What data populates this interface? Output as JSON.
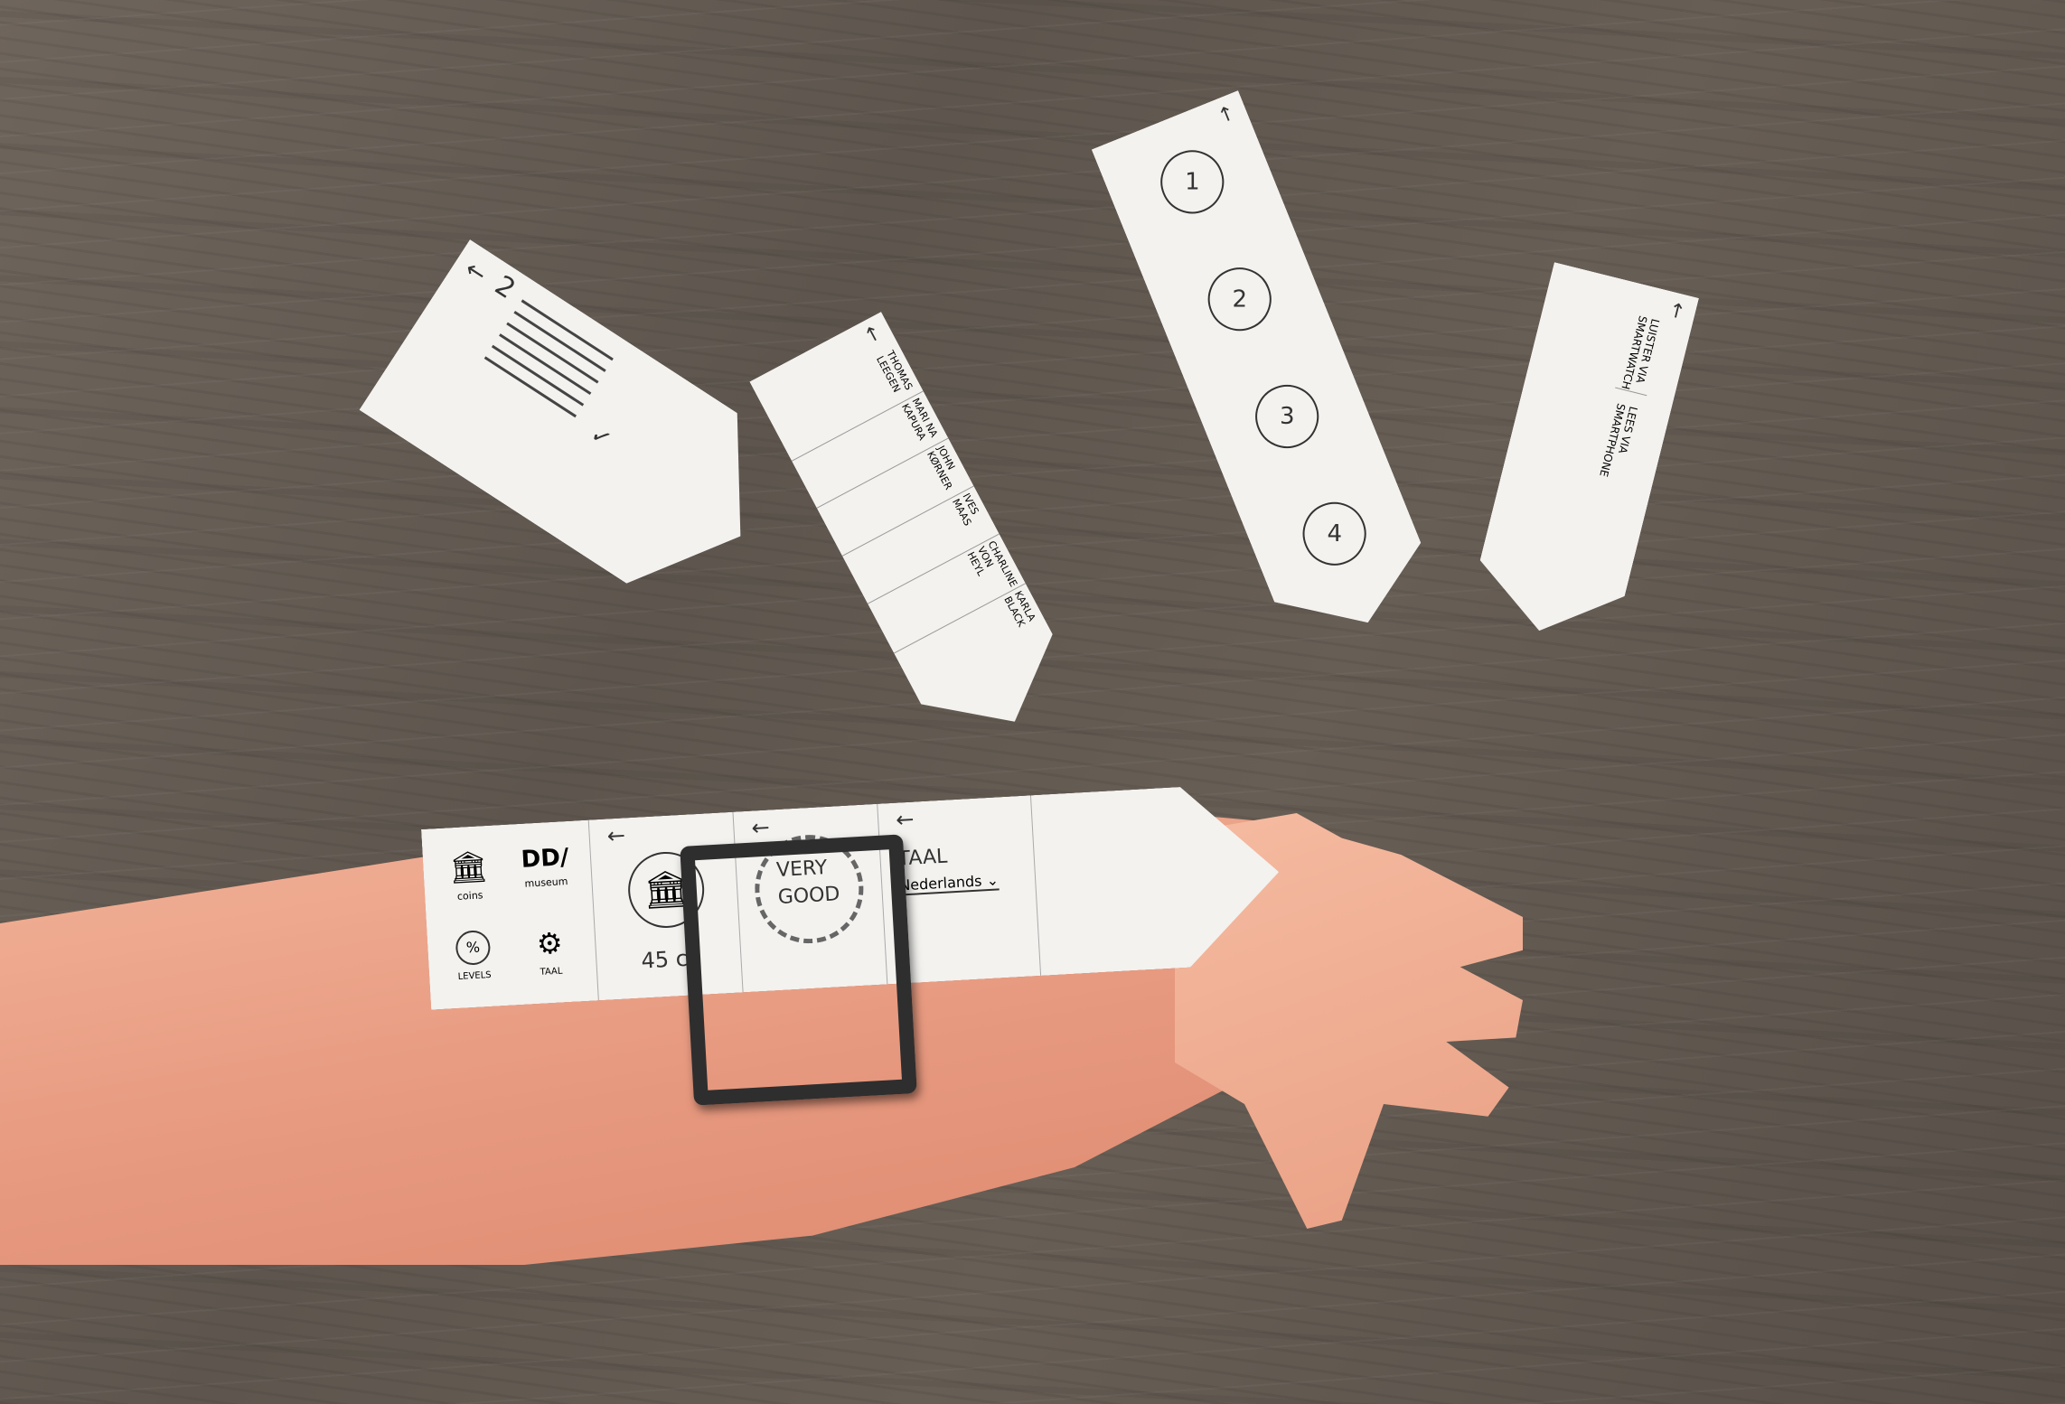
{
  "cards": {
    "text_card": {
      "page_number": "2"
    },
    "names_card": {
      "items": [
        "THOMAS LEEGEN",
        "MARI NA KAPURA",
        "JOHN KØRNER",
        "IVES MAAS",
        "CHARLINE VON HEYL",
        "KARLA BLACK"
      ]
    },
    "numbered_card": {
      "steps": [
        "1",
        "2",
        "3",
        "4"
      ]
    },
    "audio_card": {
      "option1": "LUISTER VIA SMARTWATCH",
      "option2": "LEES VIA SMARTPHONE"
    }
  },
  "wrist_strip": {
    "menu": {
      "coins_label": "coins",
      "museum_label": "museum",
      "levels_label": "LEVELS",
      "taal_label": "TAAL"
    },
    "museum_value": "45 c",
    "rating_line1": "VERY",
    "rating_line2": "GOOD",
    "language_title": "TAAL",
    "language_value": "Nederlands"
  }
}
